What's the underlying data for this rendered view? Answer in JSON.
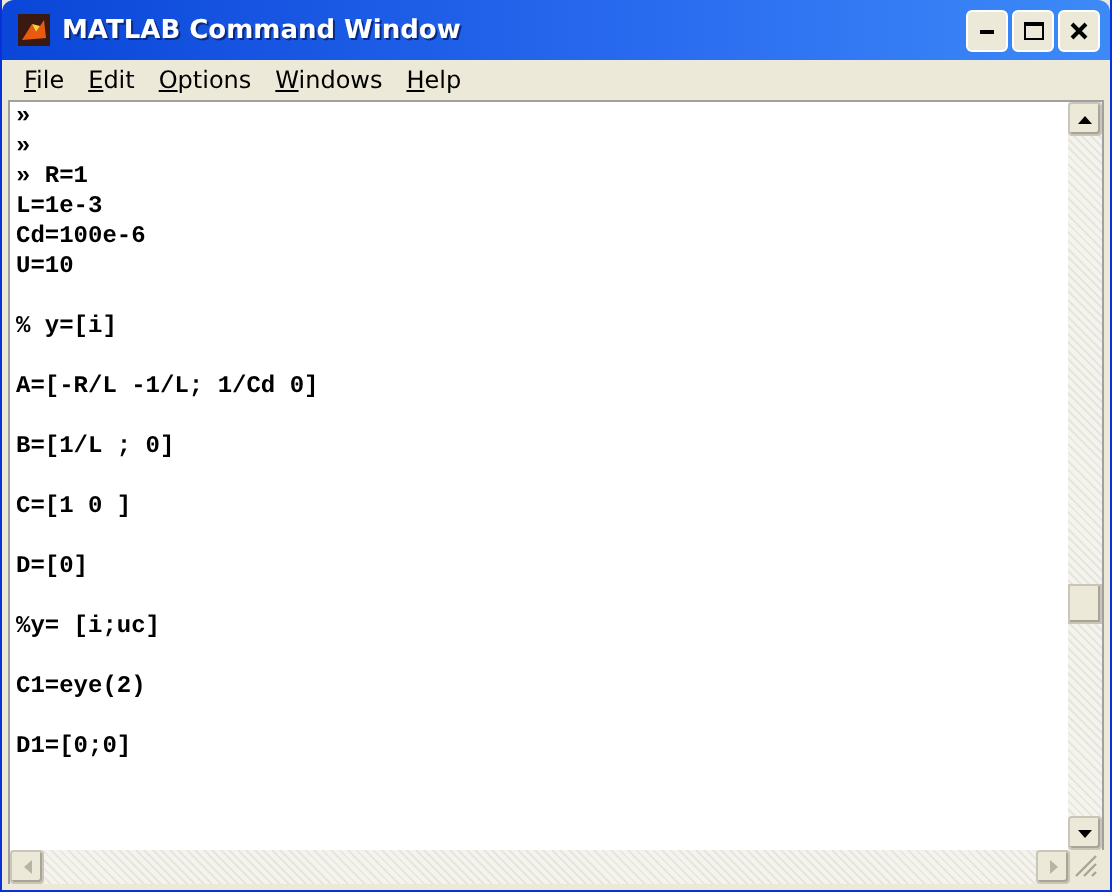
{
  "window": {
    "title": "MATLAB Command Window"
  },
  "menu": [
    {
      "label": "File"
    },
    {
      "label": "Edit"
    },
    {
      "label": "Options"
    },
    {
      "label": "Windows"
    },
    {
      "label": "Help"
    }
  ],
  "command_blocks": [
    [
      "»",
      "»",
      "» R=1",
      "L=1e-3",
      "Cd=100e-6",
      "U=10"
    ],
    [
      "% y=[i]"
    ],
    [
      "A=[-R/L -1/L; 1/Cd 0]"
    ],
    [
      "B=[1/L ; 0]"
    ],
    [
      "C=[1 0 ]"
    ],
    [
      "D=[0]"
    ],
    [
      "%y= [i;uc]"
    ],
    [
      "C1=eye(2)"
    ],
    [
      "D1=[0;0]"
    ]
  ]
}
